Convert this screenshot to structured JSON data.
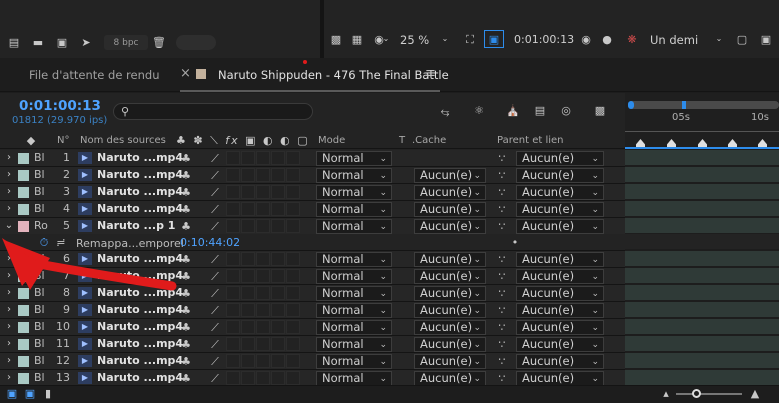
{
  "top_left_toolbar": {
    "bpc": "8 bpc"
  },
  "viewer_toolbar": {
    "zoom": "25 %",
    "timecode": "0:01:00:13",
    "resolution": "Un demi"
  },
  "tabs": [
    {
      "label": "File d'attente de rendu",
      "close": ""
    },
    {
      "label": "Naruto Shippuden - 476 The Final Battle",
      "close": "×",
      "menu": "≡"
    }
  ],
  "comp": {
    "timecode": "0:01:00:13",
    "frames": "01812 (29.970 ips)",
    "search_placeholder": ""
  },
  "ruler": {
    "ticks": [
      "05s",
      "10s"
    ]
  },
  "headers": {
    "num": "N°",
    "source": "Nom des sources",
    "mode": "Mode",
    "t": "T",
    "cache": ".Cache",
    "parent": "Parent et lien"
  },
  "layers": [
    {
      "label": "Bl",
      "num": "1",
      "name": "Naruto ...mp4",
      "mode": "Normal",
      "cache": "",
      "parent": "Aucun(e)",
      "color": "#a9c9c4",
      "expanded": false
    },
    {
      "label": "Bl",
      "num": "2",
      "name": "Naruto ...mp4",
      "mode": "Normal",
      "cache": "Aucun(e)",
      "parent": "Aucun(e)",
      "color": "#a9c9c4",
      "expanded": false
    },
    {
      "label": "Bl",
      "num": "3",
      "name": "Naruto ...mp4",
      "mode": "Normal",
      "cache": "Aucun(e)",
      "parent": "Aucun(e)",
      "color": "#a9c9c4",
      "expanded": false
    },
    {
      "label": "Bl",
      "num": "4",
      "name": "Naruto ...mp4",
      "mode": "Normal",
      "cache": "Aucun(e)",
      "parent": "Aucun(e)",
      "color": "#a9c9c4",
      "expanded": false
    },
    {
      "label": "Ro",
      "num": "5",
      "name": "Naruto ...p 1",
      "mode": "Normal",
      "cache": "Aucun(e)",
      "parent": "Aucun(e)",
      "color": "#e3b3bd",
      "expanded": true
    },
    {
      "label": "Bl",
      "num": "6",
      "name": "Naruto ...mp4",
      "mode": "Normal",
      "cache": "Aucun(e)",
      "parent": "Aucun(e)",
      "color": "#a9c9c4",
      "expanded": false
    },
    {
      "label": "Bl",
      "num": "7",
      "name": "Naruto ...mp4",
      "mode": "Normal",
      "cache": "Aucun(e)",
      "parent": "Aucun(e)",
      "color": "#a9c9c4",
      "expanded": false
    },
    {
      "label": "Bl",
      "num": "8",
      "name": "Naruto ...mp4",
      "mode": "Normal",
      "cache": "Aucun(e)",
      "parent": "Aucun(e)",
      "color": "#a9c9c4",
      "expanded": false
    },
    {
      "label": "Bl",
      "num": "9",
      "name": "Naruto ...mp4",
      "mode": "Normal",
      "cache": "Aucun(e)",
      "parent": "Aucun(e)",
      "color": "#a9c9c4",
      "expanded": false
    },
    {
      "label": "Bl",
      "num": "10",
      "name": "Naruto ...mp4",
      "mode": "Normal",
      "cache": "Aucun(e)",
      "parent": "Aucun(e)",
      "color": "#a9c9c4",
      "expanded": false
    },
    {
      "label": "Bl",
      "num": "11",
      "name": "Naruto ...mp4",
      "mode": "Normal",
      "cache": "Aucun(e)",
      "parent": "Aucun(e)",
      "color": "#a9c9c4",
      "expanded": false
    },
    {
      "label": "Bl",
      "num": "12",
      "name": "Naruto ...mp4",
      "mode": "Normal",
      "cache": "Aucun(e)",
      "parent": "Aucun(e)",
      "color": "#a9c9c4",
      "expanded": false
    },
    {
      "label": "Bl",
      "num": "13",
      "name": "Naruto ...mp4",
      "mode": "Normal",
      "cache": "Aucun(e)",
      "parent": "Aucun(e)",
      "color": "#a9c9c4",
      "expanded": false
    }
  ],
  "property": {
    "name": "Remappa...emporel",
    "value": "0:10:44:02"
  },
  "colors": {
    "accent_blue": "#2d8ceb",
    "annotation_red": "#e01b1b",
    "timeline_bar": "#2f3a37"
  }
}
